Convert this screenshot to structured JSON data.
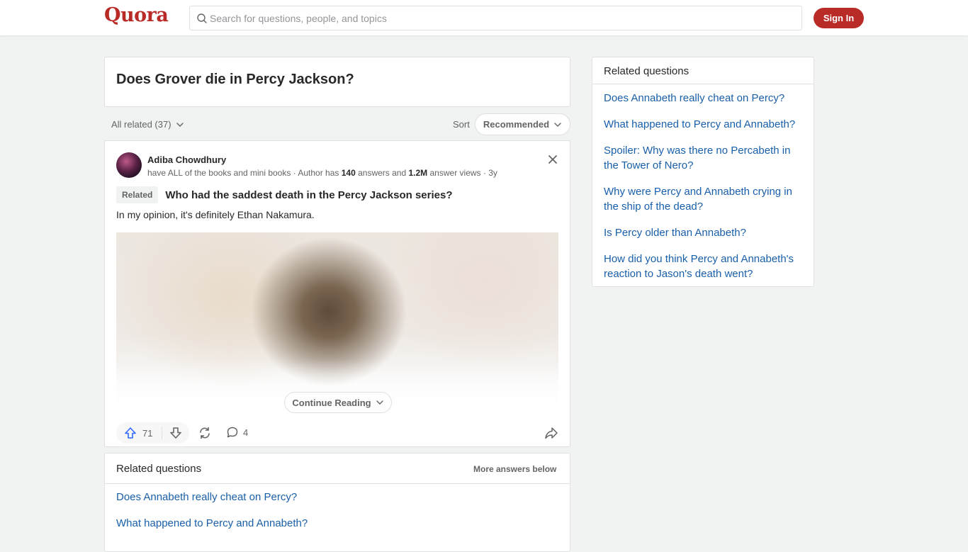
{
  "header": {
    "logo": "Quora",
    "search_placeholder": "Search for questions, people, and topics",
    "signin_label": "Sign In"
  },
  "question": {
    "title": "Does Grover die in Percy Jackson?"
  },
  "filters": {
    "all_related": "All related (37)",
    "sort_label": "Sort",
    "sort_value": "Recommended"
  },
  "answer": {
    "author": "Adiba Chowdhury",
    "cred_prefix": "have ALL of the books and mini books · Author has ",
    "answers_count": "140",
    "cred_mid": " answers and ",
    "views_count": "1.2M",
    "cred_suffix": " answer views · 3y",
    "related_badge": "Related",
    "related_question": "Who had the saddest death in the Percy Jackson series?",
    "snippet": "In my opinion, it's definitely Ethan Nakamura.",
    "continue_label": "Continue Reading",
    "upvotes": "71",
    "comments": "4"
  },
  "related_inline": {
    "title": "Related questions",
    "more": "More answers below",
    "items": [
      "Does Annabeth really cheat on Percy?",
      "What happened to Percy and Annabeth?"
    ]
  },
  "sidebar": {
    "title": "Related questions",
    "items": [
      "Does Annabeth really cheat on Percy?",
      "What happened to Percy and Annabeth?",
      "Spoiler: Why was there no Percabeth in the Tower of Nero?",
      "Why were Percy and Annabeth crying in the ship of the dead?",
      "Is Percy older than Annabeth?",
      "How did you think Percy and Annabeth's reaction to Jason's death went?"
    ]
  },
  "colors": {
    "brand": "#b92b27",
    "link": "#195faa",
    "upvote": "#2e69ff"
  },
  "icons": [
    "search-icon",
    "chevron-down-icon",
    "close-icon",
    "upvote-icon",
    "downvote-icon",
    "share-icon",
    "comment-icon",
    "forward-icon"
  ]
}
